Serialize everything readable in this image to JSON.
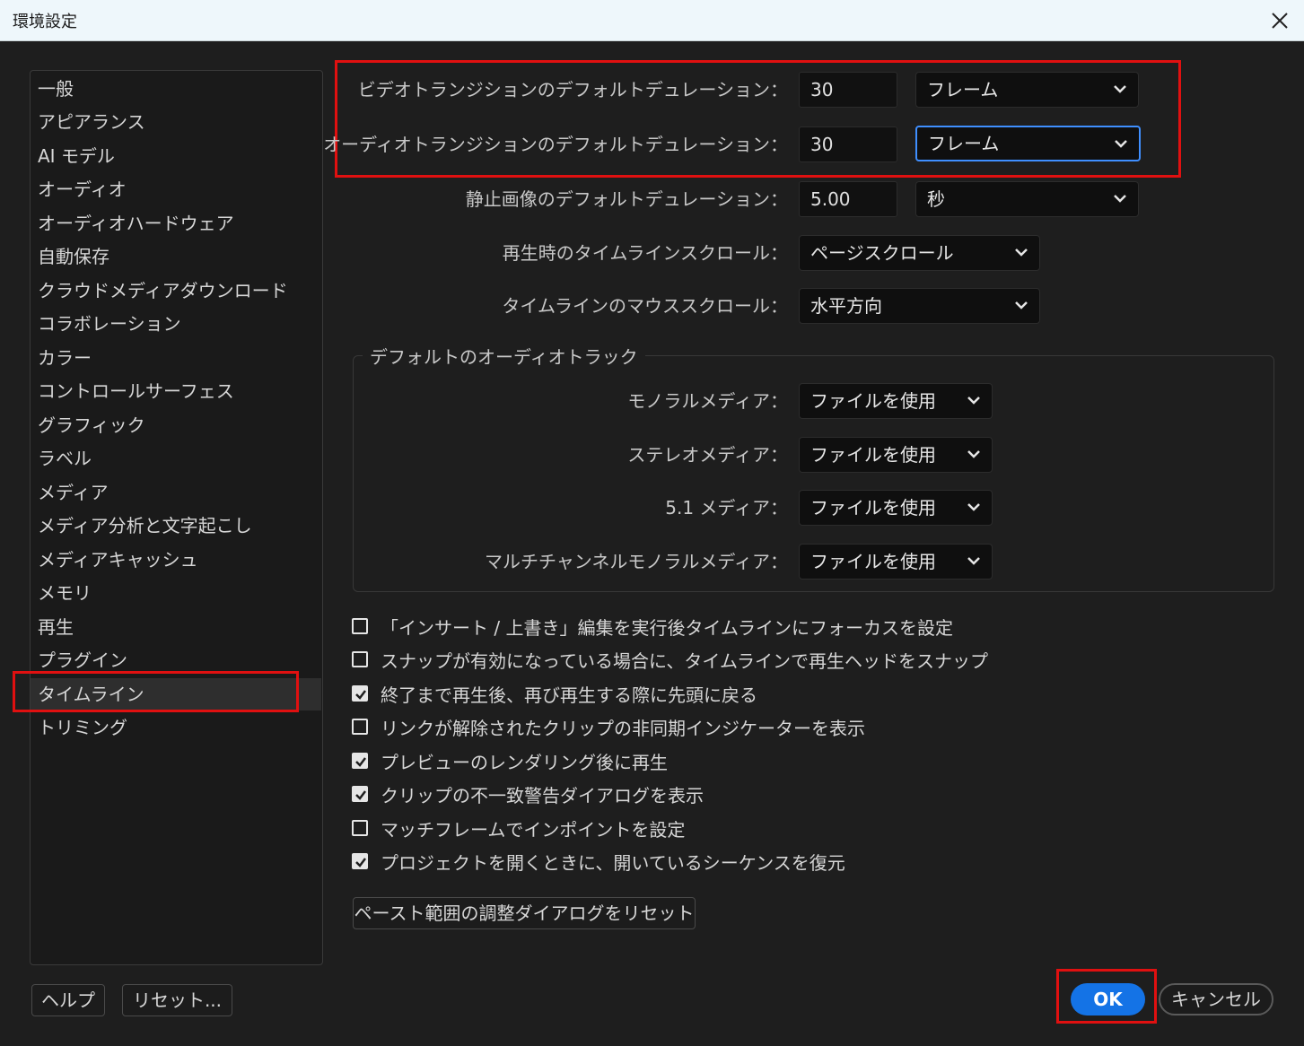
{
  "window": {
    "title": "環境設定"
  },
  "sidebar": {
    "items": [
      {
        "label": "一般"
      },
      {
        "label": "アピアランス"
      },
      {
        "label": "AI モデル"
      },
      {
        "label": "オーディオ"
      },
      {
        "label": "オーディオハードウェア"
      },
      {
        "label": "自動保存"
      },
      {
        "label": "クラウドメディアダウンロード"
      },
      {
        "label": "コラボレーション"
      },
      {
        "label": "カラー"
      },
      {
        "label": "コントロールサーフェス"
      },
      {
        "label": "グラフィック"
      },
      {
        "label": "ラベル"
      },
      {
        "label": "メディア"
      },
      {
        "label": "メディア分析と文字起こし"
      },
      {
        "label": "メディアキャッシュ"
      },
      {
        "label": "メモリ"
      },
      {
        "label": "再生"
      },
      {
        "label": "プラグイン"
      },
      {
        "label": "タイムライン",
        "selected": true
      },
      {
        "label": "トリミング"
      }
    ]
  },
  "timeline": {
    "video_transition": {
      "label": "ビデオトランジションのデフォルトデュレーション：",
      "value": "30",
      "unit": "フレーム"
    },
    "audio_transition": {
      "label": "オーディオトランジションのデフォルトデュレーション：",
      "value": "30",
      "unit": "フレーム"
    },
    "still_image": {
      "label": "静止画像のデフォルトデュレーション：",
      "value": "5.00",
      "unit": "秒"
    },
    "playback_scroll": {
      "label": "再生時のタイムラインスクロール：",
      "value": "ページスクロール"
    },
    "mouse_scroll": {
      "label": "タイムラインのマウススクロール：",
      "value": "水平方向"
    }
  },
  "audio_tracks": {
    "title": "デフォルトのオーディオトラック",
    "rows": [
      {
        "label": "モノラルメディア：",
        "value": "ファイルを使用"
      },
      {
        "label": "ステレオメディア：",
        "value": "ファイルを使用"
      },
      {
        "label": "5.1 メディア：",
        "value": "ファイルを使用"
      },
      {
        "label": "マルチチャンネルモノラルメディア：",
        "value": "ファイルを使用"
      }
    ]
  },
  "checkboxes": [
    {
      "label": "「インサート / 上書き」編集を実行後タイムラインにフォーカスを設定",
      "checked": false
    },
    {
      "label": "スナップが有効になっている場合に、タイムラインで再生ヘッドをスナップ",
      "checked": false
    },
    {
      "label": "終了まで再生後、再び再生する際に先頭に戻る",
      "checked": true
    },
    {
      "label": "リンクが解除されたクリップの非同期インジケーターを表示",
      "checked": false
    },
    {
      "label": "プレビューのレンダリング後に再生",
      "checked": true
    },
    {
      "label": "クリップの不一致警告ダイアログを表示",
      "checked": true
    },
    {
      "label": "マッチフレームでインポイントを設定",
      "checked": false
    },
    {
      "label": "プロジェクトを開くときに、開いているシーケンスを復元",
      "checked": true
    }
  ],
  "buttons": {
    "reset_paste": "ペースト範囲の調整ダイアログをリセット",
    "help": "ヘルプ",
    "reset": "リセット...",
    "ok": "OK",
    "cancel": "キャンセル"
  },
  "colors": {
    "accent": "#1473e6",
    "highlight": "#e01010",
    "background": "#1e1e1e"
  }
}
